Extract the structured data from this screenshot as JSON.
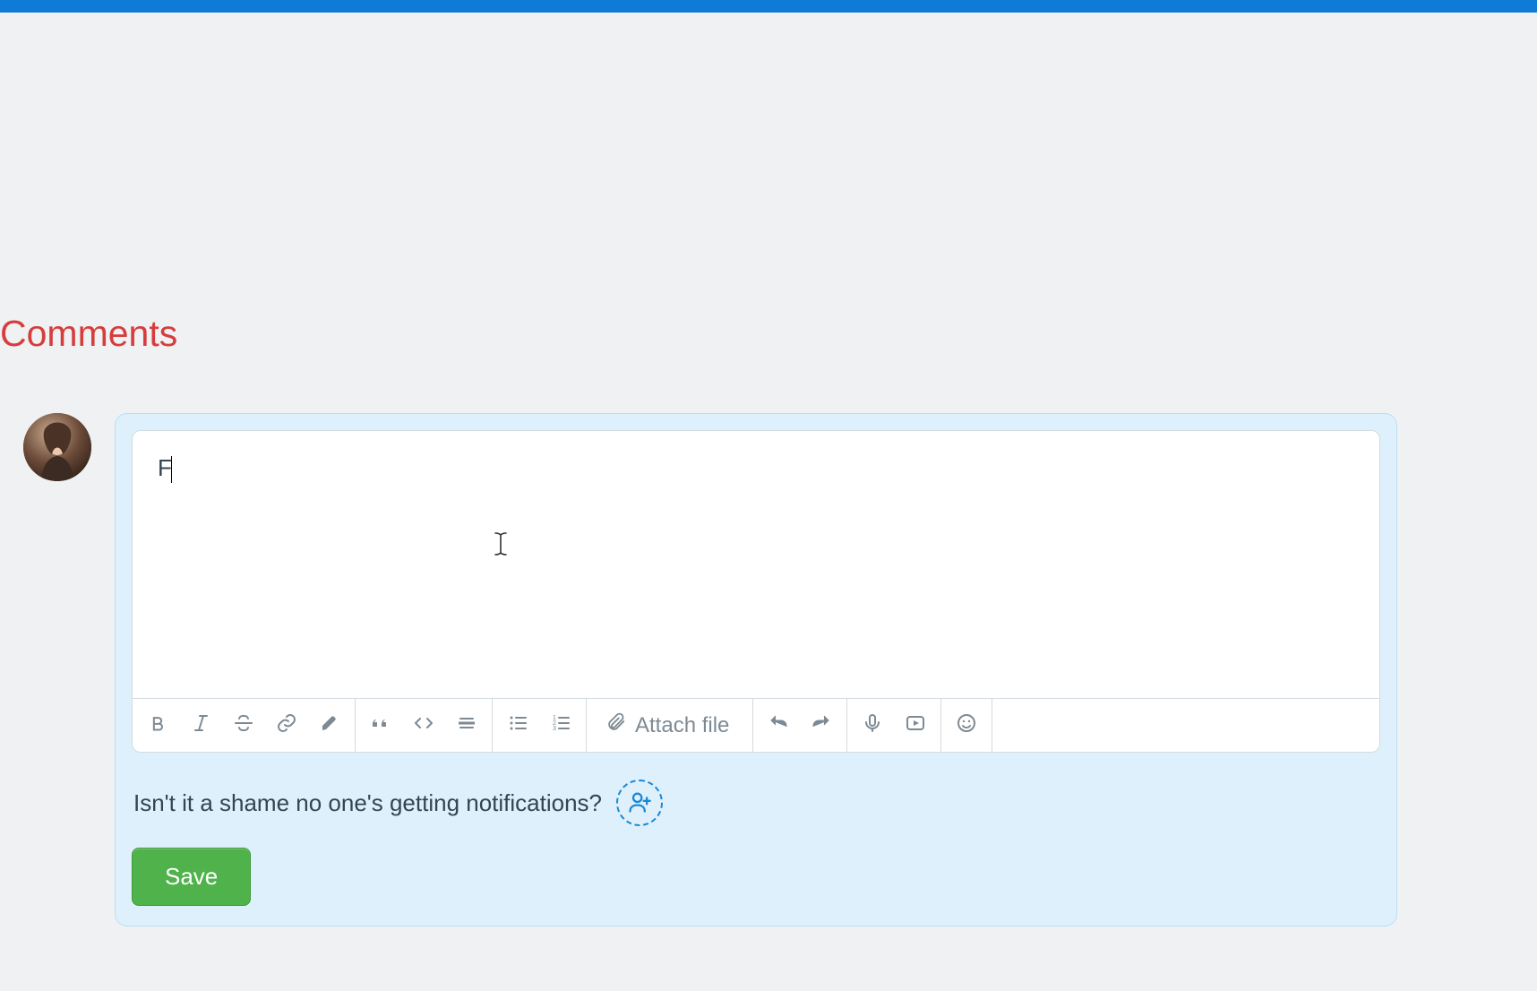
{
  "section": {
    "heading": "Comments"
  },
  "editor": {
    "content": "F",
    "attach_label": "Attach file"
  },
  "notify": {
    "text": "Isn't it a shame no one's getting notifications?"
  },
  "actions": {
    "save_label": "Save"
  },
  "toolbar": {
    "bold": "Bold",
    "italic": "Italic",
    "strike": "Strikethrough",
    "link": "Link",
    "highlight": "Highlight",
    "quote": "Blockquote",
    "code": "Code",
    "hr": "Horizontal rule",
    "ul": "Bullet list",
    "ol": "Numbered list",
    "attach": "Attach file",
    "undo": "Undo",
    "redo": "Redo",
    "mic": "Record audio",
    "video": "Record video",
    "emoji": "Emoji"
  }
}
